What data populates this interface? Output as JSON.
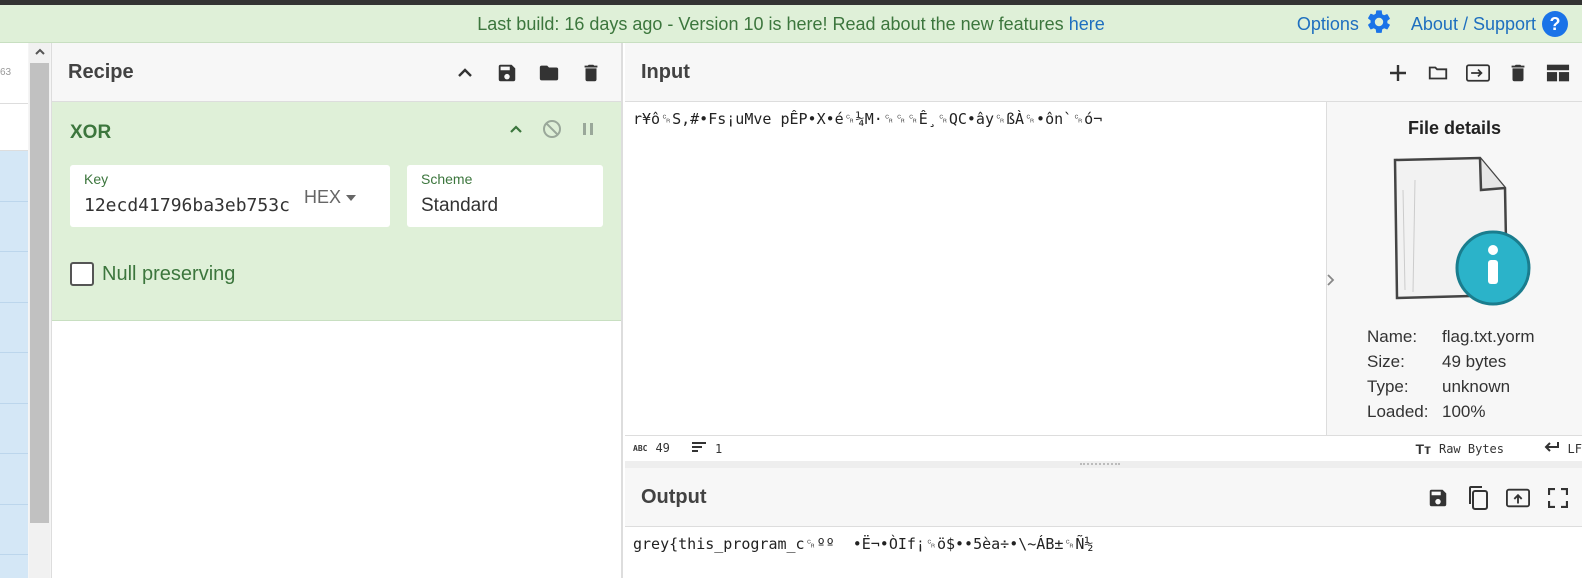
{
  "banner": {
    "message_prefix": "Last build: 16 days ago - Version 10 is here! Read about the new features",
    "message_link": "here",
    "options_label": "Options",
    "about_label": "About / Support",
    "about_icon_text": "?"
  },
  "ops": {
    "top_number": "63",
    "scroll_arrow": "^"
  },
  "recipe": {
    "title": "Recipe",
    "operation": {
      "name": "XOR",
      "key_label": "Key",
      "key_value": "12ecd41796ba3eb753c",
      "key_format": "HEX",
      "scheme_label": "Scheme",
      "scheme_value": "Standard",
      "null_preserving_label": "Null preserving"
    }
  },
  "input": {
    "title": "Input",
    "text": "r¥ô␍S,#•Fs¡uMve pÊP•X•é␍¼M·␍␍␍Ê¸␍QC•ây␍ßÀ␍•ôn`␍ó¬",
    "status": {
      "chars": "49",
      "lines": "1",
      "encoding": "Raw Bytes",
      "eol": "LF"
    }
  },
  "file_details": {
    "title": "File details",
    "name_label": "Name:",
    "name_value": "flag.txt.yorm",
    "size_label": "Size:",
    "size_value": "49 bytes",
    "type_label": "Type:",
    "type_value": "unknown",
    "loaded_label": "Loaded:",
    "loaded_value": "100%"
  },
  "output": {
    "title": "Output",
    "text": "grey{this_program_c␍ºº  •Ë¬•ÒIf¡␍ö$••5èa÷•\\~ÁB±␍Ñ½"
  },
  "colors": {
    "banner_bg": "#dff0d8",
    "operation_bg": "#dff0d8",
    "link": "#1e6fbf",
    "op_green": "#3c763d"
  }
}
